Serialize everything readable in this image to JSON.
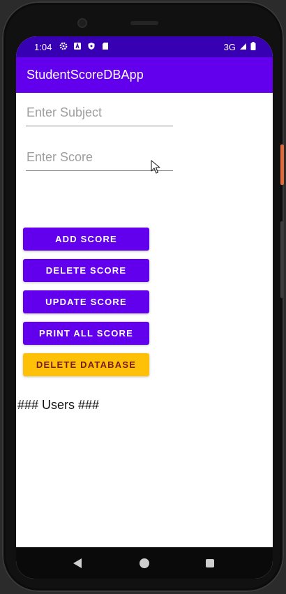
{
  "status_bar": {
    "time": "1:04",
    "network": "3G",
    "left_icons": [
      "settings-gear-icon",
      "a-badge-icon",
      "shield-icon",
      "sd-card-icon"
    ]
  },
  "app_bar": {
    "title": "StudentScoreDBApp"
  },
  "form": {
    "subject_placeholder": "Enter Subject",
    "score_placeholder": "Enter Score",
    "subject_value": "",
    "score_value": ""
  },
  "buttons": {
    "add_score": "ADD SCORE",
    "delete_score": "DELETE SCORE",
    "update_score": "UPDATE SCORE",
    "print_all_score": "PRINT ALL SCORE",
    "delete_database": "DELETE DATABASE"
  },
  "output": {
    "users_text": "### Users ###"
  },
  "colors": {
    "status_bar": "#3700b3",
    "app_bar": "#6200ee",
    "primary_button": "#6200ee",
    "warning_button": "#ffc107",
    "warning_button_text": "#7a1a1a"
  },
  "nav_bar": {
    "icons": [
      "back-icon",
      "home-icon",
      "recents-icon"
    ]
  }
}
